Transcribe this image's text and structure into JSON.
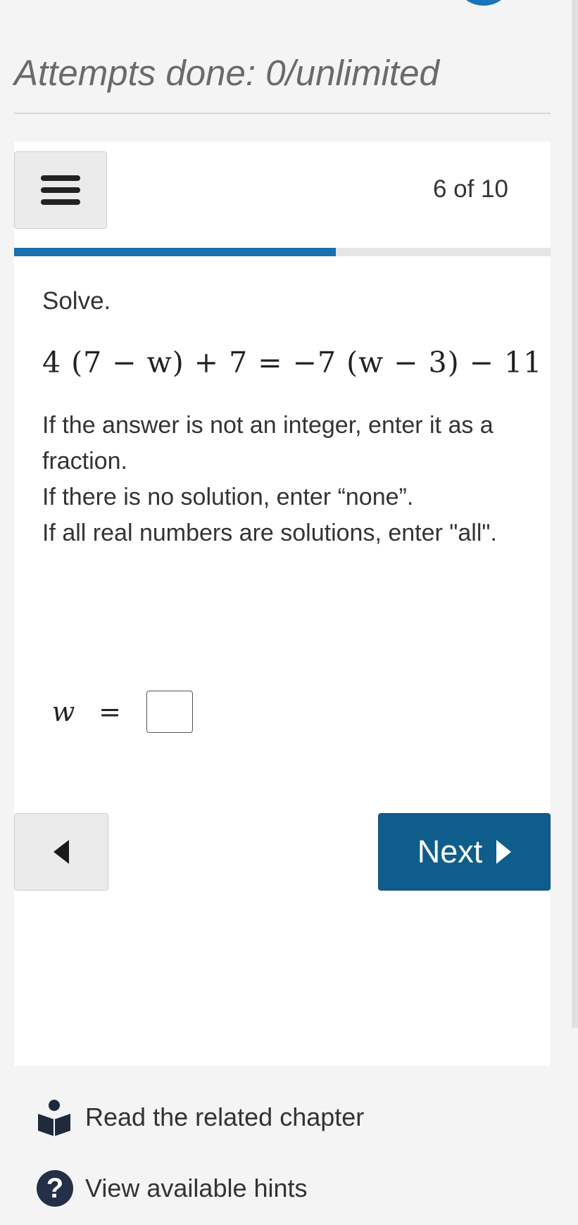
{
  "header": {
    "attempts_text": "Attempts done: 0/unlimited"
  },
  "card": {
    "progress": {
      "label": "6 of 10",
      "current": 6,
      "total": 10,
      "fill_fraction": 0.6
    },
    "question": {
      "prompt": "Solve.",
      "equation": "4 (7 − w) + 7  =  −7 (w − 3) − 11",
      "instructions": [
        "If the answer is not an integer, enter it as a fraction.",
        "If there is no solution, enter “none”.",
        "If all real numbers are solutions, enter \"all\"."
      ],
      "answer_variable": "w",
      "answer_equals": "=",
      "answer_value": ""
    },
    "navigation": {
      "next_label": "Next"
    }
  },
  "links": {
    "chapter_label": "Read the related chapter",
    "hints_label": "View available hints",
    "hint_icon_glyph": "?"
  },
  "icons": {
    "menu": "hamburger-menu-icon",
    "back": "triangle-left-icon",
    "next": "triangle-right-icon",
    "chapter": "book-reader-icon",
    "hints": "question-circle-icon"
  },
  "colors": {
    "accent": "#0f5d8c",
    "progress_fill": "#1a6fae",
    "hint_icon": "#233048"
  }
}
